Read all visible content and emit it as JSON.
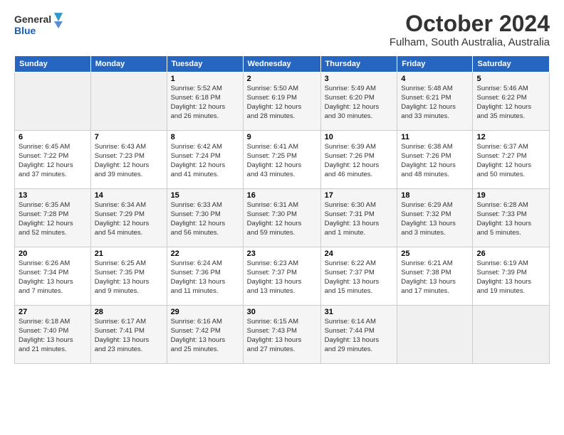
{
  "logo": {
    "line1": "General",
    "line2": "Blue"
  },
  "title": "October 2024",
  "location": "Fulham, South Australia, Australia",
  "days_of_week": [
    "Sunday",
    "Monday",
    "Tuesday",
    "Wednesday",
    "Thursday",
    "Friday",
    "Saturday"
  ],
  "weeks": [
    [
      {
        "day": "",
        "content": ""
      },
      {
        "day": "",
        "content": ""
      },
      {
        "day": "1",
        "content": "Sunrise: 5:52 AM\nSunset: 6:18 PM\nDaylight: 12 hours\nand 26 minutes."
      },
      {
        "day": "2",
        "content": "Sunrise: 5:50 AM\nSunset: 6:19 PM\nDaylight: 12 hours\nand 28 minutes."
      },
      {
        "day": "3",
        "content": "Sunrise: 5:49 AM\nSunset: 6:20 PM\nDaylight: 12 hours\nand 30 minutes."
      },
      {
        "day": "4",
        "content": "Sunrise: 5:48 AM\nSunset: 6:21 PM\nDaylight: 12 hours\nand 33 minutes."
      },
      {
        "day": "5",
        "content": "Sunrise: 5:46 AM\nSunset: 6:22 PM\nDaylight: 12 hours\nand 35 minutes."
      }
    ],
    [
      {
        "day": "6",
        "content": "Sunrise: 6:45 AM\nSunset: 7:22 PM\nDaylight: 12 hours\nand 37 minutes."
      },
      {
        "day": "7",
        "content": "Sunrise: 6:43 AM\nSunset: 7:23 PM\nDaylight: 12 hours\nand 39 minutes."
      },
      {
        "day": "8",
        "content": "Sunrise: 6:42 AM\nSunset: 7:24 PM\nDaylight: 12 hours\nand 41 minutes."
      },
      {
        "day": "9",
        "content": "Sunrise: 6:41 AM\nSunset: 7:25 PM\nDaylight: 12 hours\nand 43 minutes."
      },
      {
        "day": "10",
        "content": "Sunrise: 6:39 AM\nSunset: 7:26 PM\nDaylight: 12 hours\nand 46 minutes."
      },
      {
        "day": "11",
        "content": "Sunrise: 6:38 AM\nSunset: 7:26 PM\nDaylight: 12 hours\nand 48 minutes."
      },
      {
        "day": "12",
        "content": "Sunrise: 6:37 AM\nSunset: 7:27 PM\nDaylight: 12 hours\nand 50 minutes."
      }
    ],
    [
      {
        "day": "13",
        "content": "Sunrise: 6:35 AM\nSunset: 7:28 PM\nDaylight: 12 hours\nand 52 minutes."
      },
      {
        "day": "14",
        "content": "Sunrise: 6:34 AM\nSunset: 7:29 PM\nDaylight: 12 hours\nand 54 minutes."
      },
      {
        "day": "15",
        "content": "Sunrise: 6:33 AM\nSunset: 7:30 PM\nDaylight: 12 hours\nand 56 minutes."
      },
      {
        "day": "16",
        "content": "Sunrise: 6:31 AM\nSunset: 7:30 PM\nDaylight: 12 hours\nand 59 minutes."
      },
      {
        "day": "17",
        "content": "Sunrise: 6:30 AM\nSunset: 7:31 PM\nDaylight: 13 hours\nand 1 minute."
      },
      {
        "day": "18",
        "content": "Sunrise: 6:29 AM\nSunset: 7:32 PM\nDaylight: 13 hours\nand 3 minutes."
      },
      {
        "day": "19",
        "content": "Sunrise: 6:28 AM\nSunset: 7:33 PM\nDaylight: 13 hours\nand 5 minutes."
      }
    ],
    [
      {
        "day": "20",
        "content": "Sunrise: 6:26 AM\nSunset: 7:34 PM\nDaylight: 13 hours\nand 7 minutes."
      },
      {
        "day": "21",
        "content": "Sunrise: 6:25 AM\nSunset: 7:35 PM\nDaylight: 13 hours\nand 9 minutes."
      },
      {
        "day": "22",
        "content": "Sunrise: 6:24 AM\nSunset: 7:36 PM\nDaylight: 13 hours\nand 11 minutes."
      },
      {
        "day": "23",
        "content": "Sunrise: 6:23 AM\nSunset: 7:37 PM\nDaylight: 13 hours\nand 13 minutes."
      },
      {
        "day": "24",
        "content": "Sunrise: 6:22 AM\nSunset: 7:37 PM\nDaylight: 13 hours\nand 15 minutes."
      },
      {
        "day": "25",
        "content": "Sunrise: 6:21 AM\nSunset: 7:38 PM\nDaylight: 13 hours\nand 17 minutes."
      },
      {
        "day": "26",
        "content": "Sunrise: 6:19 AM\nSunset: 7:39 PM\nDaylight: 13 hours\nand 19 minutes."
      }
    ],
    [
      {
        "day": "27",
        "content": "Sunrise: 6:18 AM\nSunset: 7:40 PM\nDaylight: 13 hours\nand 21 minutes."
      },
      {
        "day": "28",
        "content": "Sunrise: 6:17 AM\nSunset: 7:41 PM\nDaylight: 13 hours\nand 23 minutes."
      },
      {
        "day": "29",
        "content": "Sunrise: 6:16 AM\nSunset: 7:42 PM\nDaylight: 13 hours\nand 25 minutes."
      },
      {
        "day": "30",
        "content": "Sunrise: 6:15 AM\nSunset: 7:43 PM\nDaylight: 13 hours\nand 27 minutes."
      },
      {
        "day": "31",
        "content": "Sunrise: 6:14 AM\nSunset: 7:44 PM\nDaylight: 13 hours\nand 29 minutes."
      },
      {
        "day": "",
        "content": ""
      },
      {
        "day": "",
        "content": ""
      }
    ]
  ]
}
